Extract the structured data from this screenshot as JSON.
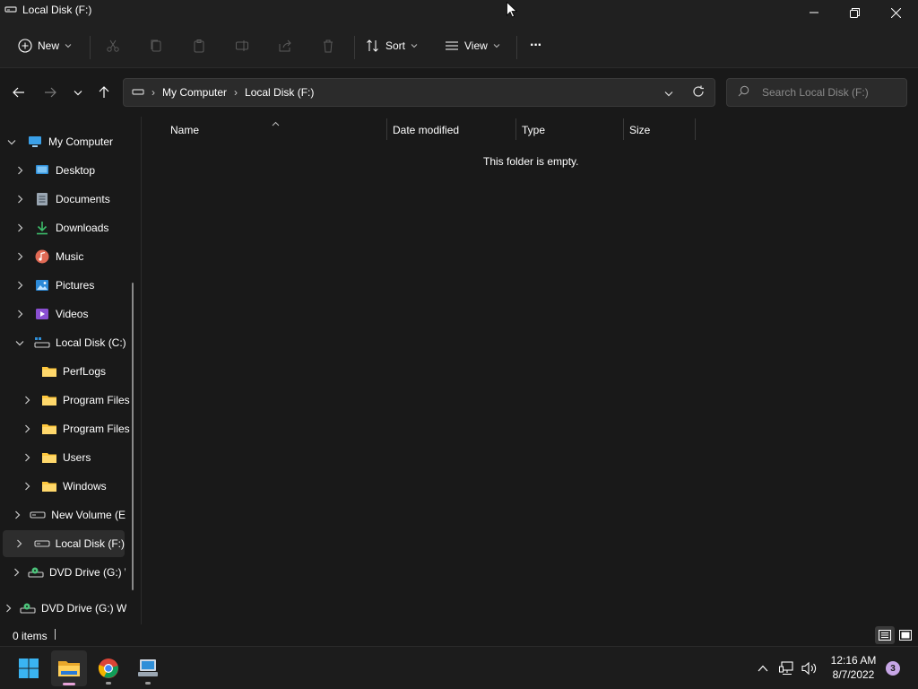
{
  "window": {
    "title": "Local Disk (F:)",
    "controls": {
      "minimize": "minimize",
      "restore": "restore",
      "close": "close"
    }
  },
  "toolbar": {
    "new_label": "New",
    "sort_label": "Sort",
    "view_label": "View",
    "more_label": "···"
  },
  "address": {
    "crumbs": [
      "My Computer",
      "Local Disk (F:)"
    ]
  },
  "search": {
    "placeholder": "Search Local Disk (F:)"
  },
  "nav": {
    "items": [
      {
        "label": "My Computer",
        "icon": "computer-icon"
      },
      {
        "label": "Desktop",
        "icon": "desktop-icon"
      },
      {
        "label": "Documents",
        "icon": "documents-icon"
      },
      {
        "label": "Downloads",
        "icon": "downloads-icon"
      },
      {
        "label": "Music",
        "icon": "music-icon"
      },
      {
        "label": "Pictures",
        "icon": "pictures-icon"
      },
      {
        "label": "Videos",
        "icon": "videos-icon"
      },
      {
        "label": "Local Disk (C:)",
        "icon": "drive-c-icon"
      },
      {
        "label": "PerfLogs",
        "icon": "folder-icon"
      },
      {
        "label": "Program Files",
        "icon": "folder-icon"
      },
      {
        "label": "Program Files",
        "icon": "folder-icon"
      },
      {
        "label": "Users",
        "icon": "folder-icon"
      },
      {
        "label": "Windows",
        "icon": "folder-icon"
      },
      {
        "label": "New Volume (E",
        "icon": "drive-icon"
      },
      {
        "label": "Local Disk (F:)",
        "icon": "drive-icon"
      },
      {
        "label": "DVD Drive (G:) \\",
        "icon": "dvd-icon"
      },
      {
        "label": "DVD Drive (G:) W",
        "icon": "dvd-icon"
      }
    ]
  },
  "columns": {
    "name": "Name",
    "date_modified": "Date modified",
    "type": "Type",
    "size": "Size"
  },
  "content": {
    "empty_message": "This folder is empty."
  },
  "status": {
    "items_count": "0 items"
  },
  "taskbar": {
    "time": "12:16 AM",
    "date": "8/7/2022",
    "notification_count": "3"
  },
  "colors": {
    "background": "#191919",
    "accent": "#0078d4",
    "folder": "#ffc83d"
  }
}
